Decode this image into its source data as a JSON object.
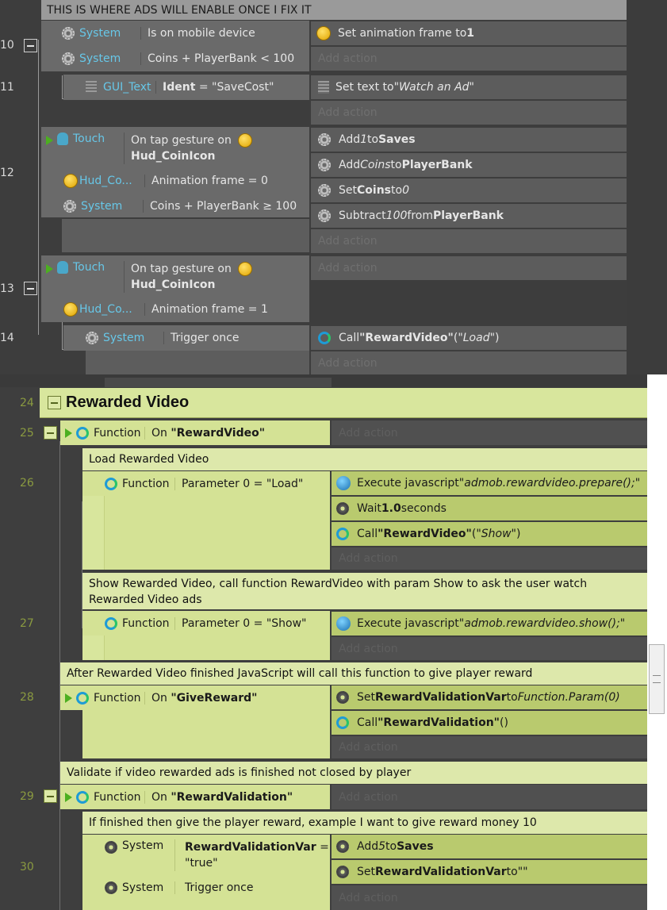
{
  "dark": {
    "banner": "THIS IS WHERE ADS WILL ENABLE ONCE I FIX IT",
    "events": [
      {
        "num": "10",
        "c1_obj": "System",
        "c1_text": "Is on mobile device",
        "c2_obj": "System",
        "c2_text": "Coins + PlayerBank < 100",
        "a1": "Set animation frame to ",
        "a1_b": "1",
        "add": "Add action"
      },
      {
        "num": "11",
        "c_obj": "GUI_Text",
        "c_b": "Ident",
        "c_rest": " = \"SaveCost\"",
        "a1": "Set text to ",
        "a1_i": "\"Watch an Ad\"",
        "add": "Add action"
      },
      {
        "num": "12",
        "c1_obj": "Touch",
        "c1_text": "On tap gesture on",
        "c1_b2": "Hud_CoinIcon",
        "c2_obj": "Hud_Co...",
        "c2_text": "Animation frame = 0",
        "c3_obj": "System",
        "c3_text": "Coins + PlayerBank ≥ 100",
        "a1_pre": "Add ",
        "a1_i": "1",
        "a1_mid": " to ",
        "a1_b": "Saves",
        "a2_pre": "Add ",
        "a2_i": "Coins",
        "a2_mid": " to ",
        "a2_b": "PlayerBank",
        "a3_pre": "Set ",
        "a3_b": "Coins",
        "a3_mid": " to ",
        "a3_i": "0",
        "a4_pre": "Subtract ",
        "a4_i": "100",
        "a4_mid": " from ",
        "a4_b": "PlayerBank",
        "add": "Add action"
      },
      {
        "num": "13",
        "c1_obj": "Touch",
        "c1_text": "On tap gesture on",
        "c1_b2": "Hud_CoinIcon",
        "c2_obj": "Hud_Co...",
        "c2_text": "Animation frame = 1",
        "add": "Add action"
      },
      {
        "num": "14",
        "c_obj": "System",
        "c_text": "Trigger once",
        "a1_pre": "Call ",
        "a1_b": "\"RewardVideo\"",
        "a1_rest": " (",
        "a1_i": "\"Load\"",
        "a1_end": ")",
        "add": "Add action"
      }
    ]
  },
  "light": {
    "group": {
      "num": "24",
      "title": "Rewarded Video"
    },
    "e25": {
      "num": "25",
      "obj": "Function",
      "text": "On ",
      "b": "\"RewardVideo\"",
      "add": "Add action"
    },
    "comment1": "Load Rewarded Video",
    "e26": {
      "num": "26",
      "obj": "Function",
      "text": "Parameter 0 = \"Load\"",
      "a1_pre": "Execute javascript ",
      "a1_i": "\"admob.rewardvideo.prepare();\"",
      "a2_pre": "Wait ",
      "a2_b": "1.0",
      "a2_post": " seconds",
      "a3_pre": "Call ",
      "a3_b": "\"RewardVideo\"",
      "a3_mid": " (",
      "a3_i": "\"Show\"",
      "a3_end": ")",
      "add": "Add action"
    },
    "comment2": "Show Rewarded Video, call function RewardVideo with param Show to ask the user watch Rewarded Video ads",
    "e27": {
      "num": "27",
      "obj": "Function",
      "text": "Parameter 0 = \"Show\"",
      "a1_pre": "Execute javascript ",
      "a1_i": "\"admob.rewardvideo.show();\"",
      "add": "Add action"
    },
    "comment3": "After Rewarded Video finished JavaScript will call this function to give player reward",
    "e28": {
      "num": "28",
      "obj": "Function",
      "text": "On ",
      "b": "\"GiveReward\"",
      "a1_pre": "Set ",
      "a1_b": "RewardValidationVar",
      "a1_mid": " to ",
      "a1_i": "Function.Param(0)",
      "a2_pre": "Call ",
      "a2_b": "\"RewardValidation\"",
      "a2_post": " ()",
      "add": "Add action"
    },
    "comment4": "Validate if video rewarded ads is finished not closed by player",
    "e29": {
      "num": "29",
      "obj": "Function",
      "text": "On ",
      "b": "\"RewardValidation\"",
      "add": "Add action"
    },
    "comment5": "If finished then give the player reward, example I want to give reward money 10",
    "e30": {
      "num": "30",
      "c1_obj": "System",
      "c1_b": "RewardValidationVar",
      "c1_rest": " =",
      "c1_line2": "\"true\"",
      "c2_obj": "System",
      "c2_text": "Trigger once",
      "a1_pre": "Add ",
      "a1_i": "5",
      "a1_mid": " to ",
      "a1_b": "Saves",
      "a2_pre": "Set ",
      "a2_b": "RewardValidationVar",
      "a2_mid": " to ",
      "a2_post": "\"\"",
      "add": "Add action"
    }
  }
}
